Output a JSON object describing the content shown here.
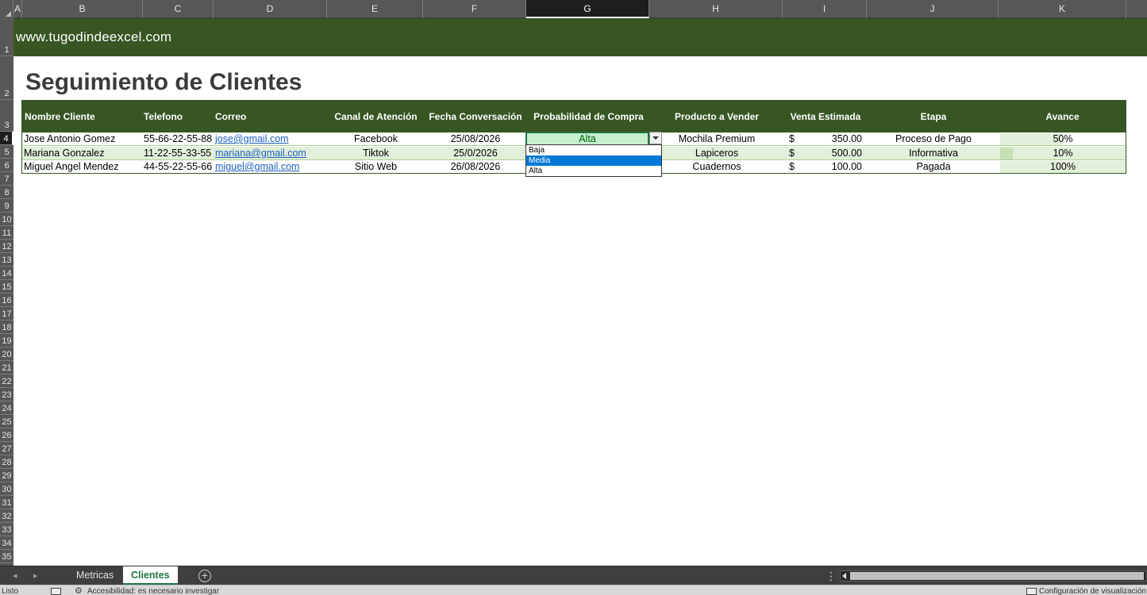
{
  "window": {
    "app": "Excel"
  },
  "columns": [
    "A",
    "B",
    "C",
    "D",
    "E",
    "F",
    "G",
    "H",
    "I",
    "J",
    "K"
  ],
  "active_column": "G",
  "rows": [
    "1",
    "2",
    "3",
    "4",
    "5",
    "6",
    "7",
    "8",
    "9",
    "10",
    "11",
    "12",
    "13",
    "14",
    "15",
    "16",
    "17",
    "18",
    "19",
    "20",
    "21",
    "22",
    "23",
    "24",
    "25",
    "26",
    "27",
    "28",
    "29",
    "30",
    "31",
    "32",
    "33",
    "34",
    "35"
  ],
  "active_row": "4",
  "sheet": {
    "site": "www.tugodindeexcel.com",
    "title": "Seguimiento de Clientes",
    "headers": [
      "Nombre Cliente",
      "Telefono",
      "Correo",
      "Canal de Atención",
      "Fecha Conversación",
      "Probabilidad de Compra",
      "Producto a Vender",
      "Venta Estimada",
      "Etapa",
      "Avance"
    ],
    "records": [
      {
        "nombre": "Jose Antonio Gomez",
        "telefono": "55-66-22-55-88",
        "correo": "jose@gmail.com",
        "canal": "Facebook",
        "fecha": "25/08/2026",
        "probabilidad": "Alta",
        "producto": "Mochila Premium",
        "moneda": "$",
        "venta": "350.00",
        "etapa": "Proceso de Pago",
        "avance": "50%",
        "avance_value": 0.5
      },
      {
        "nombre": "Mariana Gonzalez",
        "telefono": "11-22-55-33-55",
        "correo": "mariana@gmail.com",
        "canal": "Tiktok",
        "fecha": "25/0/2026",
        "probabilidad": "",
        "producto": "Lapiceros",
        "moneda": "$",
        "venta": "500.00",
        "etapa": "Informativa",
        "avance": "10%",
        "avance_value": 0.1
      },
      {
        "nombre": "Miguel Angel Mendez",
        "telefono": "44-55-22-55-66",
        "correo": "miguel@gmail.com",
        "canal": "Sitio Web",
        "fecha": "26/08/2026",
        "probabilidad": "",
        "producto": "Cuadernos",
        "moneda": "$",
        "venta": "100.00",
        "etapa": "Pagada",
        "avance": "100%",
        "avance_value": 1.0
      }
    ]
  },
  "dropdown": {
    "current": "Alta",
    "options": [
      "Baja",
      "Media",
      "Alta"
    ],
    "highlighted": "Media"
  },
  "tabs": [
    {
      "label": "Metricas",
      "active": false
    },
    {
      "label": "Clientes",
      "active": true
    }
  ],
  "tabbar": {
    "more_options": "⋮"
  },
  "status": {
    "mode": "Listo",
    "accessibility": "Accesibilidad: es necesario investigar",
    "display_settings": "Configuración de visualización"
  },
  "colors": {
    "header_green": "#375623",
    "band_green": "#e2efda",
    "active_cell": "#c6efce",
    "active_text": "#006100",
    "selection_blue": "#0078d7"
  }
}
